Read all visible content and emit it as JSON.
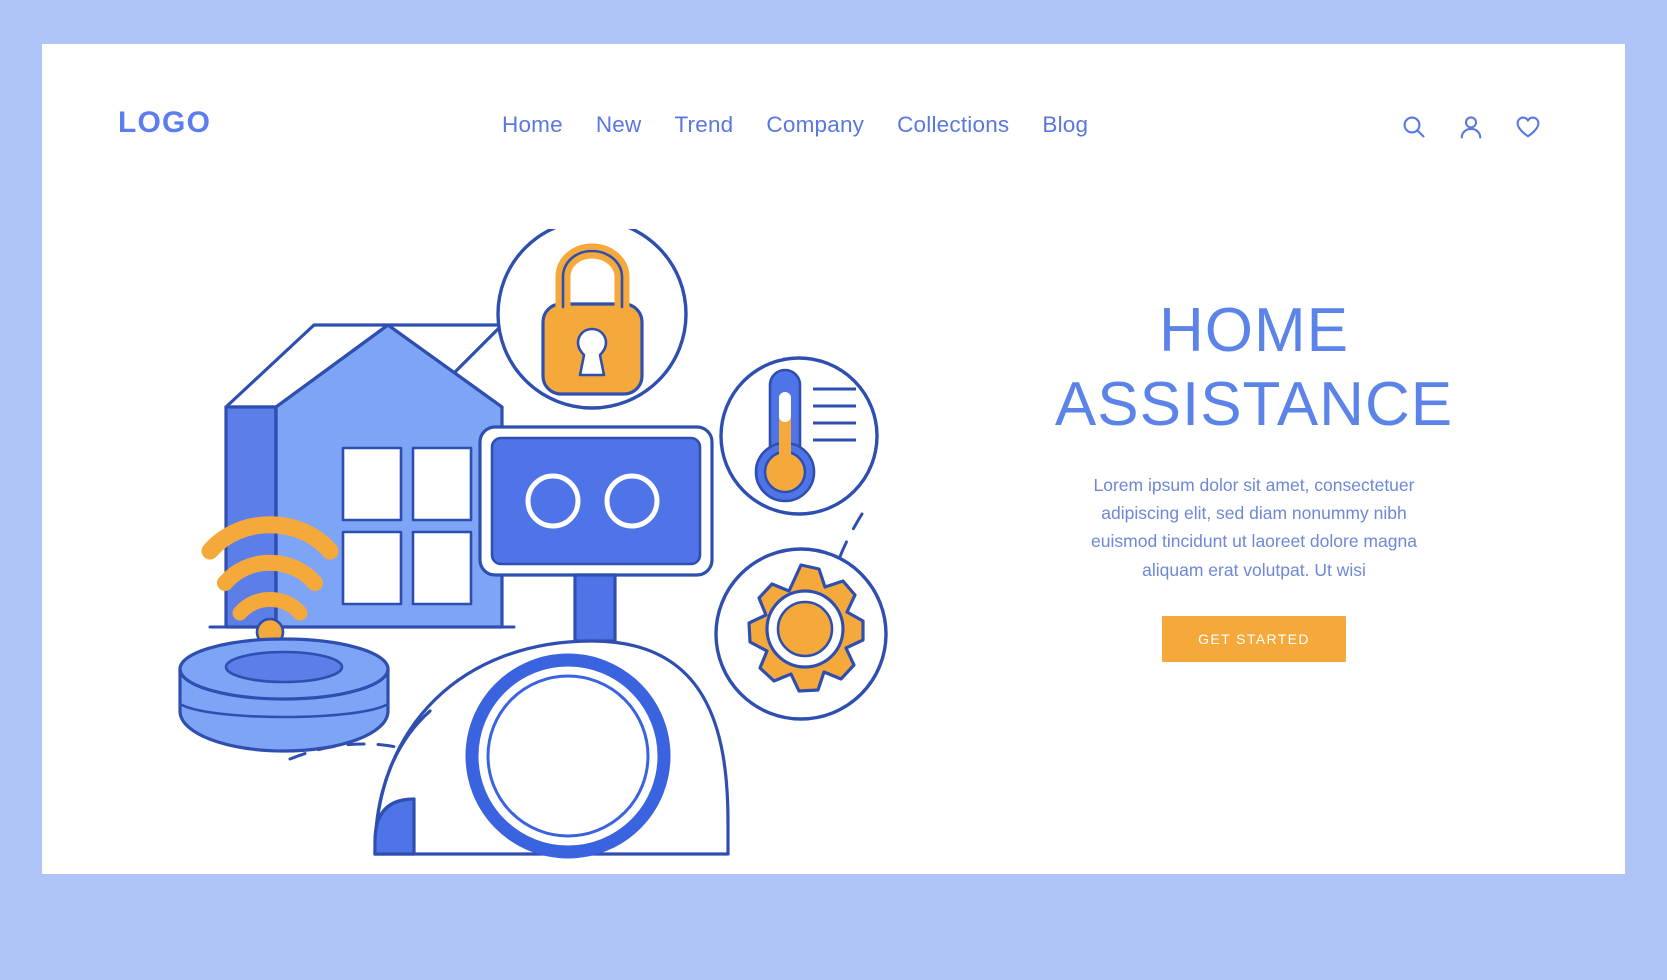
{
  "page": {
    "background_color": "#aec4f7",
    "canvas_color": "#ffffff"
  },
  "header": {
    "logo": "LOGO",
    "nav": [
      {
        "label": "Home"
      },
      {
        "label": "New"
      },
      {
        "label": "Trend"
      },
      {
        "label": "Company"
      },
      {
        "label": "Collections"
      },
      {
        "label": "Blog"
      }
    ],
    "icons": [
      {
        "name": "search-icon"
      },
      {
        "name": "user-icon"
      },
      {
        "name": "heart-icon"
      }
    ]
  },
  "hero": {
    "headline_line1": "HOME",
    "headline_line2": "ASSISTANCE",
    "paragraph": "Lorem ipsum dolor sit amet, consectetuer adipiscing elit, sed diam nonummy nibh euismod tincidunt ut laoreet dolore magna aliquam erat volutpat. Ut wisi",
    "cta_label": "GET STARTED"
  },
  "illustration": {
    "alt": "smart home assistance scene",
    "elements": [
      {
        "name": "house"
      },
      {
        "name": "wifi-signal"
      },
      {
        "name": "robot-vacuum"
      },
      {
        "name": "smart-speaker-screen"
      },
      {
        "name": "lock-badge"
      },
      {
        "name": "thermometer-badge"
      },
      {
        "name": "gear-badge"
      },
      {
        "name": "magnifier"
      }
    ]
  },
  "colors": {
    "brand_blue": "#5c7cf0",
    "nav_blue": "#5878e0",
    "headline_blue": "#5c84e8",
    "paragraph_blue": "#6d88d6",
    "accent_orange": "#f6a93b",
    "outline_blue": "#2f4fb0",
    "house_light": "#7ea4f5",
    "house_dark": "#5b7ee9",
    "page_bg": "#aec4f7"
  }
}
